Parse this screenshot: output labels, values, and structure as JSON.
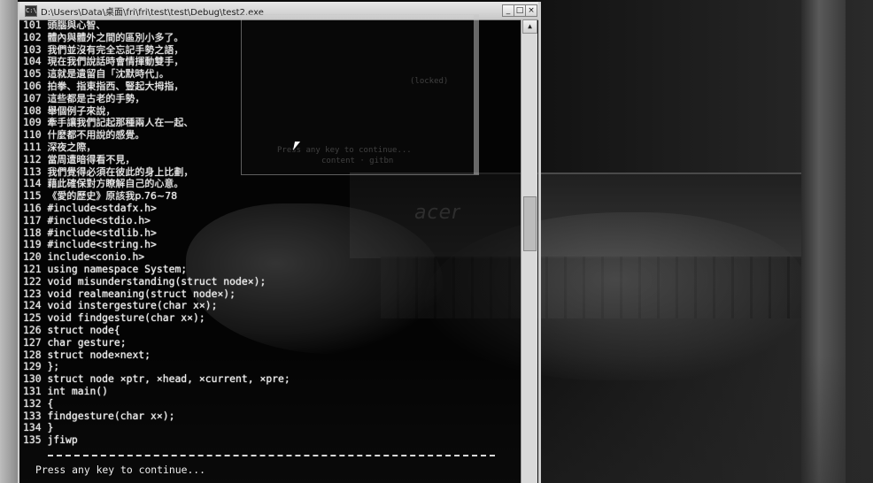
{
  "window": {
    "title": "D:\\Users\\Data\\桌面\\fri\\fri\\test\\test\\Debug\\test2.exe",
    "minimize": "_",
    "maximize": "□",
    "close": "×"
  },
  "ghost": {
    "line1": "(locked)",
    "line2": "Press any key to continue...",
    "line3": "content · gitbn"
  },
  "laptop": {
    "brand": "acer"
  },
  "lines": [
    {
      "n": "101",
      "t": "頭腦與心智、"
    },
    {
      "n": "102",
      "t": "體內與體外之間的區別小多了。"
    },
    {
      "n": "103",
      "t": "我們並沒有完全忘記手勢之語，"
    },
    {
      "n": "104",
      "t": "現在我們說話時會情揮動雙手，"
    },
    {
      "n": "105",
      "t": "這就是遺留自「沈默時代」。"
    },
    {
      "n": "106",
      "t": "拍拳、指東指西、豎起大拇指，"
    },
    {
      "n": "107",
      "t": "這些都是古老的手勢，"
    },
    {
      "n": "108",
      "t": "舉個例子來說，"
    },
    {
      "n": "109",
      "t": "牽手讓我們記起那種兩人在一起、"
    },
    {
      "n": "110",
      "t": "什麼都不用說的感覺。"
    },
    {
      "n": "111",
      "t": "深夜之際，"
    },
    {
      "n": "112",
      "t": "當周遭暗得看不見，"
    },
    {
      "n": "113",
      "t": "我們覺得必須在彼此的身上比劃，"
    },
    {
      "n": "114",
      "t": "藉此確保對方瞭解自己的心意。"
    },
    {
      "n": "115",
      "t": "《愛的歷史》原該我p.76~78"
    },
    {
      "n": "116",
      "t": "#include<stdafx.h>"
    },
    {
      "n": "117",
      "t": "#include<stdio.h>"
    },
    {
      "n": "118",
      "t": "#include<stdlib.h>"
    },
    {
      "n": "119",
      "t": "#include<string.h>"
    },
    {
      "n": "120",
      "t": "include<conio.h>"
    },
    {
      "n": "121",
      "t": "using namespace System;"
    },
    {
      "n": "122",
      "t": "void misunderstanding(struct node×);"
    },
    {
      "n": "123",
      "t": "void realmeaning(struct node×);"
    },
    {
      "n": "124",
      "t": "void instergesture(char x×);"
    },
    {
      "n": "125",
      "t": "void findgesture(char x×);"
    },
    {
      "n": "126",
      "t": "struct node{"
    },
    {
      "n": "127",
      "t": "char gesture;"
    },
    {
      "n": "128",
      "t": "struct node×next;"
    },
    {
      "n": "129",
      "t": "};"
    },
    {
      "n": "130",
      "t": "struct node ×ptr, ×head, ×current, ×pre;"
    },
    {
      "n": "131",
      "t": "int main()"
    },
    {
      "n": "132",
      "t": "{"
    },
    {
      "n": "133",
      "t": "findgesture(char x×);"
    },
    {
      "n": "134",
      "t": "}"
    },
    {
      "n": "135",
      "t": "jfiwp"
    }
  ],
  "prompt": "Press any key to continue..."
}
